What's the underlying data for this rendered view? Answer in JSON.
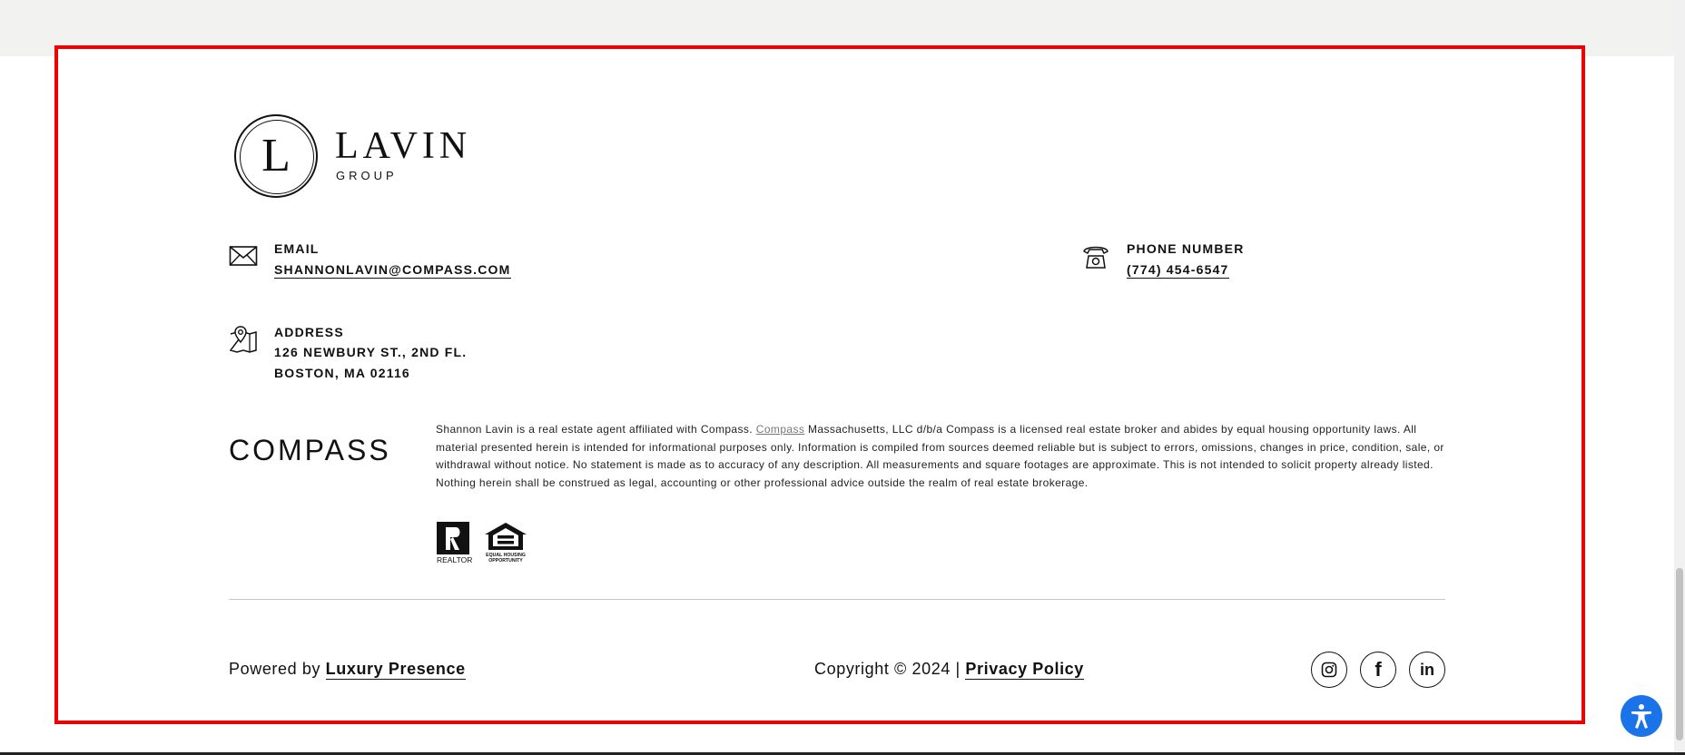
{
  "brand": {
    "logo_letter": "L",
    "logo_name": "LAVIN",
    "logo_sub": "GROUP"
  },
  "contact": {
    "email_label": "EMAIL",
    "email_value": "SHANNONLAVIN@COMPASS.COM",
    "phone_label": "PHONE NUMBER",
    "phone_value": "(774) 454-6547",
    "address_label": "ADDRESS",
    "address_line1": "126 NEWBURY ST., 2ND FL.",
    "address_line2": "BOSTON, MA 02116"
  },
  "compass": {
    "logo_text": "COMPASS",
    "disclaimer_pre": "Shannon Lavin is a real estate agent affiliated with Compass. ",
    "disclaimer_link": "Compass",
    "disclaimer_post": " Massachusetts, LLC d/b/a Compass is a licensed real estate broker and abides by equal housing opportunity laws. All material presented herein is intended for informational purposes only. Information is compiled from sources deemed reliable but is subject to errors, omissions, changes in price, condition, sale, or withdrawal without notice. No statement is made as to accuracy of any description. All measurements and square footages are approximate. This is not intended to solicit property already listed. Nothing herein shall be construed as legal, accounting or other professional advice outside the realm of real estate brokerage.",
    "realtor_badge_text": "REALTOR",
    "eho_badge_text_1": "EQUAL HOUSING",
    "eho_badge_text_2": "OPPORTUNITY"
  },
  "bottom": {
    "powered_prefix": "Powered by ",
    "powered_link": "Luxury Presence",
    "copyright_prefix": "Copyright © 2024 | ",
    "privacy_link": "Privacy Policy"
  },
  "social": {
    "instagram_icon": "instagram-icon",
    "facebook_icon": "facebook-icon",
    "linkedin_icon": "linkedin-icon",
    "linkedin_text": "in",
    "facebook_text": "f"
  },
  "colors": {
    "frame": "#ee0000",
    "accessibility": "#1a73e8",
    "top_band": "#f2f2f0"
  }
}
